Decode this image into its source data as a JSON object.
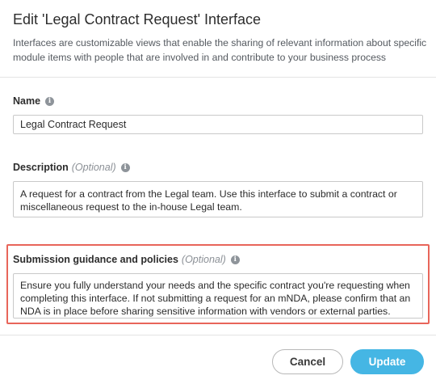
{
  "dialog": {
    "title": "Edit 'Legal Contract Request' Interface",
    "subtitle": "Interfaces are customizable views that enable the sharing of relevant information about specific module items with people that are involved in and contribute to your business process"
  },
  "fields": {
    "name": {
      "label": "Name",
      "value": "Legal Contract Request"
    },
    "description": {
      "label": "Description",
      "optional": "(Optional)",
      "value": "A request for a contract from the Legal team. Use this interface to submit a contract or miscellaneous request to the in-house Legal team."
    },
    "guidance": {
      "label": "Submission guidance and policies",
      "optional": "(Optional)",
      "value": "Ensure you fully understand your needs and the specific contract you're requesting when completing this interface. If not submitting a request for an mNDA, please confirm that an NDA is in place before sharing sensitive information with vendors or external parties."
    }
  },
  "footer": {
    "cancel_label": "Cancel",
    "update_label": "Update"
  },
  "colors": {
    "accent": "#45b6e4",
    "highlight": "#e8655a"
  },
  "icons": {
    "info": "info-icon"
  }
}
